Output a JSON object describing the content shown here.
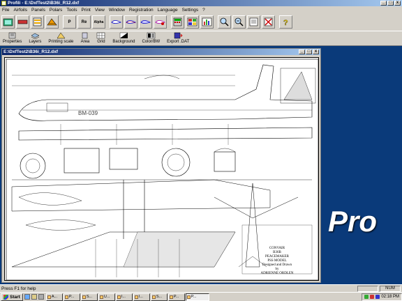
{
  "app": {
    "title": "Profili - E:\\DxfTest2\\B36i_R12.dxf",
    "minimize": "_",
    "maximize": "□",
    "close": "x"
  },
  "menu": [
    "File",
    "Airfoils",
    "Panels",
    "Polars",
    "Tools",
    "Print",
    "View",
    "Window",
    "Registration",
    "Language",
    "Settings",
    "?"
  ],
  "toolbar1": {
    "buttons": [
      "open-icon",
      "save-icon",
      "panel-icon",
      "rib-icon",
      "p-icon",
      "re-icon",
      "alpha-icon",
      "foil-icon",
      "foil2-icon",
      "foil3-icon",
      "foil4-icon",
      "calc-icon",
      "db-icon",
      "chart-icon",
      "zoom-in-icon",
      "zoom-out-icon",
      "page-icon",
      "close-doc-icon",
      "help-icon"
    ],
    "text": {
      "p": "P",
      "re": "Re",
      "alpha": "Alpha"
    }
  },
  "toolbar2": [
    {
      "name": "properties",
      "label": "Properties"
    },
    {
      "name": "layers",
      "label": "Layers"
    },
    {
      "name": "printing-scale",
      "label": "Printing scale"
    },
    {
      "name": "area",
      "label": "Area"
    },
    {
      "name": "grid",
      "label": "Grid"
    },
    {
      "name": "background",
      "label": "Background"
    },
    {
      "name": "color-bw",
      "label": "Color/BW"
    },
    {
      "name": "export-dat",
      "label": "Export .DAT"
    }
  ],
  "document": {
    "title": "E:\\DxfTest2\\B36i_R12.dxf",
    "tail_number": "BM-039",
    "drawing_title": [
      "CONVAIR",
      "B36B",
      "PEACEMAKER",
      "PSS MODEL",
      "Designed and Drawn",
      "by",
      "ADRIENNE ORDLEN"
    ]
  },
  "pro_label": "Pro",
  "status": {
    "message": "Press F1 for help",
    "num": "NUM"
  },
  "taskbar": {
    "start": "Start",
    "items": [
      "A...",
      "P...",
      "S...",
      "U...",
      "I...",
      "I...",
      "S...",
      "P...",
      "P..."
    ],
    "clock": "02:18 PM"
  },
  "colors": {
    "title_bar": "#0a246a",
    "mdi_background": "#0a3a7a",
    "chrome": "#d4d0c8"
  }
}
